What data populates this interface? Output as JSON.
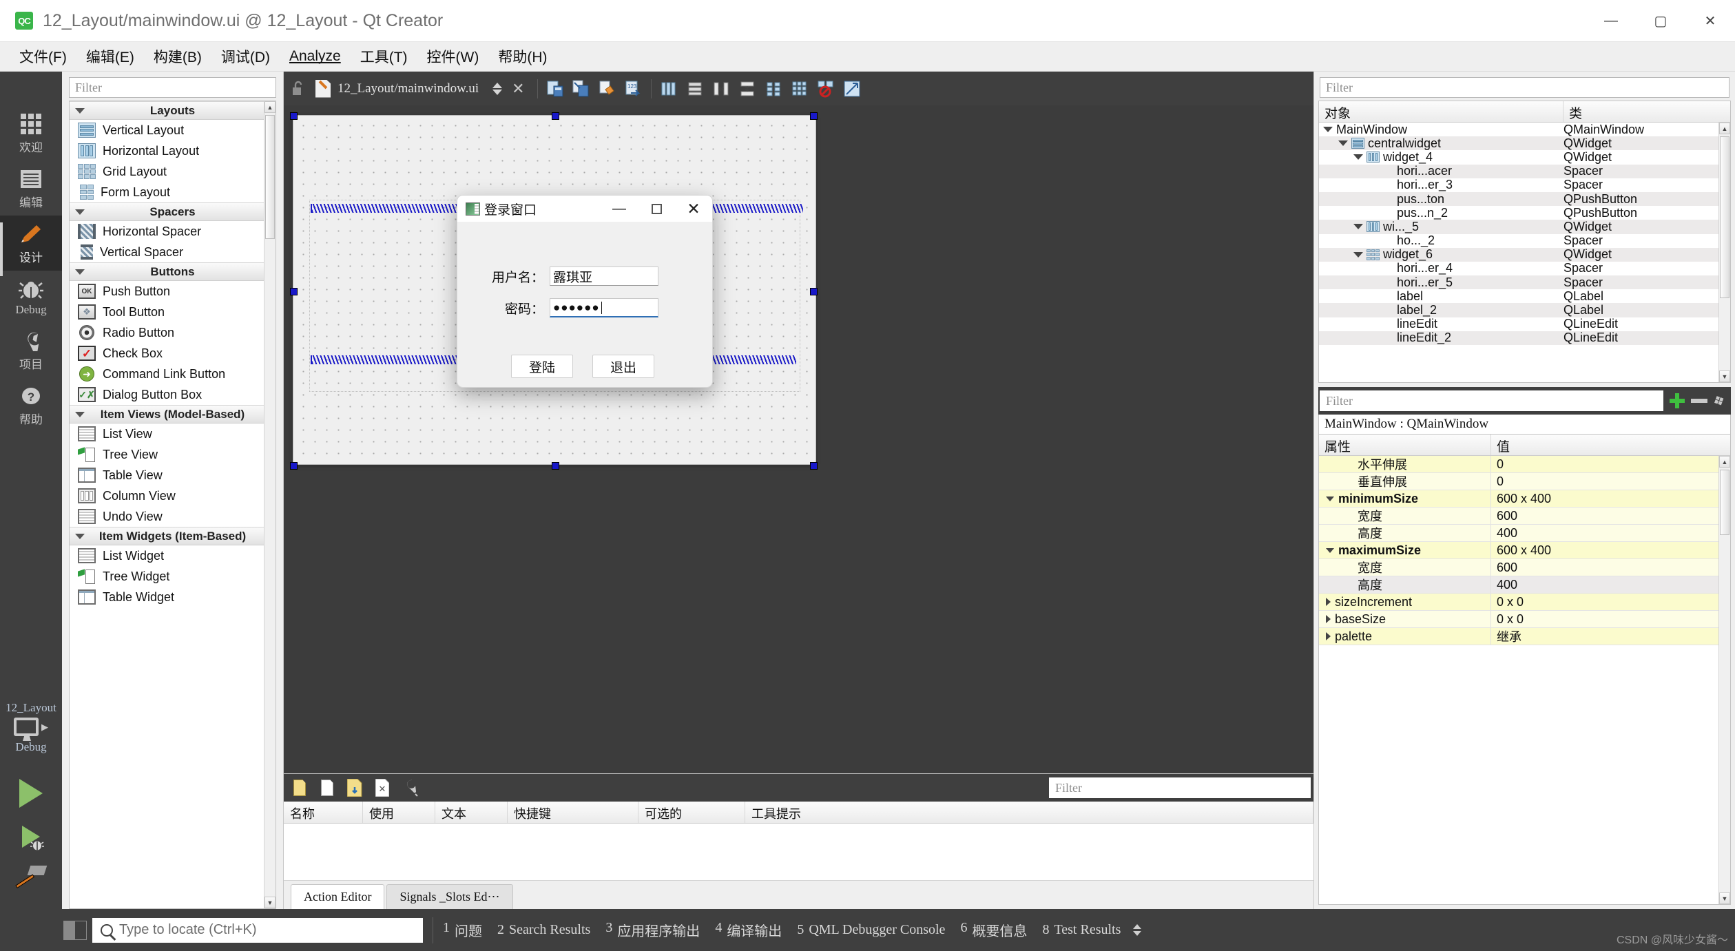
{
  "window": {
    "title": "12_Layout/mainwindow.ui @ 12_Layout - Qt Creator",
    "app_badge": "QC",
    "minimize": "—",
    "maximize": "▢",
    "close": "✕"
  },
  "menubar": [
    {
      "label": "文件(F)",
      "mnemonic": "F"
    },
    {
      "label": "编辑(E)",
      "mnemonic": "E"
    },
    {
      "label": "构建(B)",
      "mnemonic": "B"
    },
    {
      "label": "调试(D)",
      "mnemonic": "D"
    },
    {
      "label": "Analyze",
      "mnemonic": "A"
    },
    {
      "label": "工具(T)",
      "mnemonic": "T"
    },
    {
      "label": "控件(W)",
      "mnemonic": "W"
    },
    {
      "label": "帮助(H)",
      "mnemonic": "H"
    }
  ],
  "modebar": {
    "modes": [
      {
        "label": "欢迎",
        "icon": "grid-icon",
        "active": false
      },
      {
        "label": "编辑",
        "icon": "lines-icon",
        "active": false
      },
      {
        "label": "设计",
        "icon": "pencil-icon",
        "active": true
      },
      {
        "label": "Debug",
        "icon": "bug-icon",
        "active": false
      },
      {
        "label": "项目",
        "icon": "wrench-icon",
        "active": false
      },
      {
        "label": "帮助",
        "icon": "question-icon",
        "active": false
      }
    ],
    "project_name": "12_Layout",
    "kit_label": "Debug",
    "run_button": "run-icon",
    "debug_button": "run-debug-icon",
    "build_button": "hammer-icon"
  },
  "widgetbox": {
    "filter_placeholder": "Filter",
    "categories": [
      {
        "title": "Layouts",
        "items": [
          {
            "label": "Vertical Layout",
            "icon": "vertical-layout-icon"
          },
          {
            "label": "Horizontal Layout",
            "icon": "horizontal-layout-icon"
          },
          {
            "label": "Grid Layout",
            "icon": "grid-layout-icon"
          },
          {
            "label": "Form Layout",
            "icon": "form-layout-icon"
          }
        ]
      },
      {
        "title": "Spacers",
        "items": [
          {
            "label": "Horizontal Spacer",
            "icon": "horizontal-spacer-icon"
          },
          {
            "label": "Vertical Spacer",
            "icon": "vertical-spacer-icon"
          }
        ]
      },
      {
        "title": "Buttons",
        "items": [
          {
            "label": "Push Button",
            "icon": "push-button-icon"
          },
          {
            "label": "Tool Button",
            "icon": "tool-button-icon"
          },
          {
            "label": "Radio Button",
            "icon": "radio-button-icon"
          },
          {
            "label": "Check Box",
            "icon": "check-box-icon"
          },
          {
            "label": "Command Link Button",
            "icon": "command-link-icon"
          },
          {
            "label": "Dialog Button Box",
            "icon": "dialog-button-box-icon"
          }
        ]
      },
      {
        "title": "Item Views (Model-Based)",
        "items": [
          {
            "label": "List View",
            "icon": "list-view-icon"
          },
          {
            "label": "Tree View",
            "icon": "tree-view-icon"
          },
          {
            "label": "Table View",
            "icon": "table-view-icon"
          },
          {
            "label": "Column View",
            "icon": "column-view-icon"
          },
          {
            "label": "Undo View",
            "icon": "undo-view-icon"
          }
        ]
      },
      {
        "title": "Item Widgets (Item-Based)",
        "items": [
          {
            "label": "List Widget",
            "icon": "list-widget-icon"
          },
          {
            "label": "Tree Widget",
            "icon": "tree-widget-icon"
          },
          {
            "label": "Table Widget",
            "icon": "table-widget-icon"
          }
        ]
      }
    ]
  },
  "editorbar": {
    "lock_icon": "unlocked-icon",
    "file_icon": "ui-file-icon",
    "file_name": "12_Layout/mainwindow.ui",
    "nav_updown": "spin-updown-icon",
    "close_icon": "close-document-icon",
    "tools": [
      "edit-widgets-icon",
      "edit-signals-slots-icon",
      "edit-buddies-icon",
      "edit-tab-order-icon",
      "layout-horizontally-icon",
      "layout-vertically-icon",
      "layout-in-splitter-h-icon",
      "layout-in-splitter-v-icon",
      "layout-form-icon",
      "layout-grid-icon",
      "break-layout-icon",
      "adjust-size-icon"
    ]
  },
  "form_preview": {
    "dialog": {
      "title": "登录窗口",
      "icon": "window-icon",
      "minimize": "—",
      "maximize": "▢",
      "close": "✕",
      "fields": [
        {
          "label": "用户名：",
          "value": "露琪亚",
          "type": "text"
        },
        {
          "label": "密码：",
          "value": "●●●●●●",
          "type": "password"
        }
      ],
      "buttons": [
        {
          "label": "登陆"
        },
        {
          "label": "退出"
        }
      ]
    }
  },
  "action_editor": {
    "toolbar_icons": [
      "new-action-icon",
      "copy-action-icon",
      "paste-action-icon",
      "delete-action-icon",
      "edit-action-icon"
    ],
    "filter_placeholder": "Filter",
    "columns": [
      "名称",
      "使用",
      "文本",
      "快捷键",
      "可选的",
      "工具提示"
    ],
    "rows": [],
    "tabs": [
      {
        "label": "Action Editor",
        "active": true
      },
      {
        "label": "Signals _Slots Ed⋯",
        "active": false
      }
    ]
  },
  "object_inspector": {
    "filter_placeholder": "Filter",
    "columns": [
      "对象",
      "类"
    ],
    "rows": [
      {
        "name": "MainWindow",
        "class": "QMainWindow",
        "indent": 0,
        "twist": "open",
        "icon": null
      },
      {
        "name": "centralwidget",
        "class": "QWidget",
        "indent": 1,
        "twist": "open",
        "icon": "vertical-layout-icon"
      },
      {
        "name": "widget_4",
        "class": "QWidget",
        "indent": 2,
        "twist": "open",
        "icon": "horizontal-layout-icon"
      },
      {
        "name": "hori...acer",
        "class": "Spacer",
        "indent": 4,
        "twist": null,
        "icon": null
      },
      {
        "name": "hori...er_3",
        "class": "Spacer",
        "indent": 4,
        "twist": null,
        "icon": null
      },
      {
        "name": "pus...ton",
        "class": "QPushButton",
        "indent": 4,
        "twist": null,
        "icon": null
      },
      {
        "name": "pus...n_2",
        "class": "QPushButton",
        "indent": 4,
        "twist": null,
        "icon": null
      },
      {
        "name": "wi..._5",
        "class": "QWidget",
        "indent": 2,
        "twist": "open",
        "icon": "horizontal-layout-icon"
      },
      {
        "name": "ho..._2",
        "class": "Spacer",
        "indent": 4,
        "twist": null,
        "icon": null
      },
      {
        "name": "widget_6",
        "class": "QWidget",
        "indent": 2,
        "twist": "open",
        "icon": "grid-layout-icon"
      },
      {
        "name": "hori...er_4",
        "class": "Spacer",
        "indent": 4,
        "twist": null,
        "icon": null
      },
      {
        "name": "hori...er_5",
        "class": "Spacer",
        "indent": 4,
        "twist": null,
        "icon": null
      },
      {
        "name": "label",
        "class": "QLabel",
        "indent": 4,
        "twist": null,
        "icon": null
      },
      {
        "name": "label_2",
        "class": "QLabel",
        "indent": 4,
        "twist": null,
        "icon": null
      },
      {
        "name": "lineEdit",
        "class": "QLineEdit",
        "indent": 4,
        "twist": null,
        "icon": null
      },
      {
        "name": "lineEdit_2",
        "class": "QLineEdit",
        "indent": 4,
        "twist": null,
        "icon": null
      }
    ]
  },
  "property_editor": {
    "filter_placeholder": "Filter",
    "add_icon": "plus-icon",
    "remove_icon": "minus-icon",
    "configure_icon": "wrench-icon",
    "selected_object": "MainWindow : QMainWindow",
    "columns": [
      "属性",
      "值"
    ],
    "rows": [
      {
        "name": "水平伸展",
        "value": "0",
        "indent": 1,
        "twist": null,
        "bold": false,
        "style": "yellow"
      },
      {
        "name": "垂直伸展",
        "value": "0",
        "indent": 1,
        "twist": null,
        "bold": false,
        "style": "pale"
      },
      {
        "name": "minimumSize",
        "value": "600 x 400",
        "indent": 0,
        "twist": "open",
        "bold": true,
        "style": "yellow"
      },
      {
        "name": "宽度",
        "value": "600",
        "indent": 1,
        "twist": null,
        "bold": false,
        "style": "pale"
      },
      {
        "name": "高度",
        "value": "400",
        "indent": 1,
        "twist": null,
        "bold": false,
        "style": "pale"
      },
      {
        "name": "maximumSize",
        "value": "600 x 400",
        "indent": 0,
        "twist": "open",
        "bold": true,
        "style": "yellow"
      },
      {
        "name": "宽度",
        "value": "600",
        "indent": 1,
        "twist": null,
        "bold": false,
        "style": "pale"
      },
      {
        "name": "高度",
        "value": "400",
        "indent": 1,
        "twist": null,
        "bold": false,
        "style": "grey"
      },
      {
        "name": "sizeIncrement",
        "value": "0 x 0",
        "indent": 0,
        "twist": "closed",
        "bold": false,
        "style": "yellow"
      },
      {
        "name": "baseSize",
        "value": "0 x 0",
        "indent": 0,
        "twist": "closed",
        "bold": false,
        "style": "pale"
      },
      {
        "name": "palette",
        "value": "继承",
        "indent": 0,
        "twist": "closed",
        "bold": false,
        "style": "yellow"
      }
    ]
  },
  "statusbar": {
    "sidebar_toggle": "sidebar-toggle-icon",
    "locate_icon": "search-icon",
    "locate_placeholder": "Type to locate (Ctrl+K)",
    "tabs": [
      {
        "num": "1",
        "label": "问题"
      },
      {
        "num": "2",
        "label": "Search Results"
      },
      {
        "num": "3",
        "label": "应用程序输出"
      },
      {
        "num": "4",
        "label": "编译输出"
      },
      {
        "num": "5",
        "label": "QML Debugger Console"
      },
      {
        "num": "6",
        "label": "概要信息"
      },
      {
        "num": "8",
        "label": "Test Results"
      }
    ],
    "watermark": "CSDN @风味少女酱～"
  }
}
